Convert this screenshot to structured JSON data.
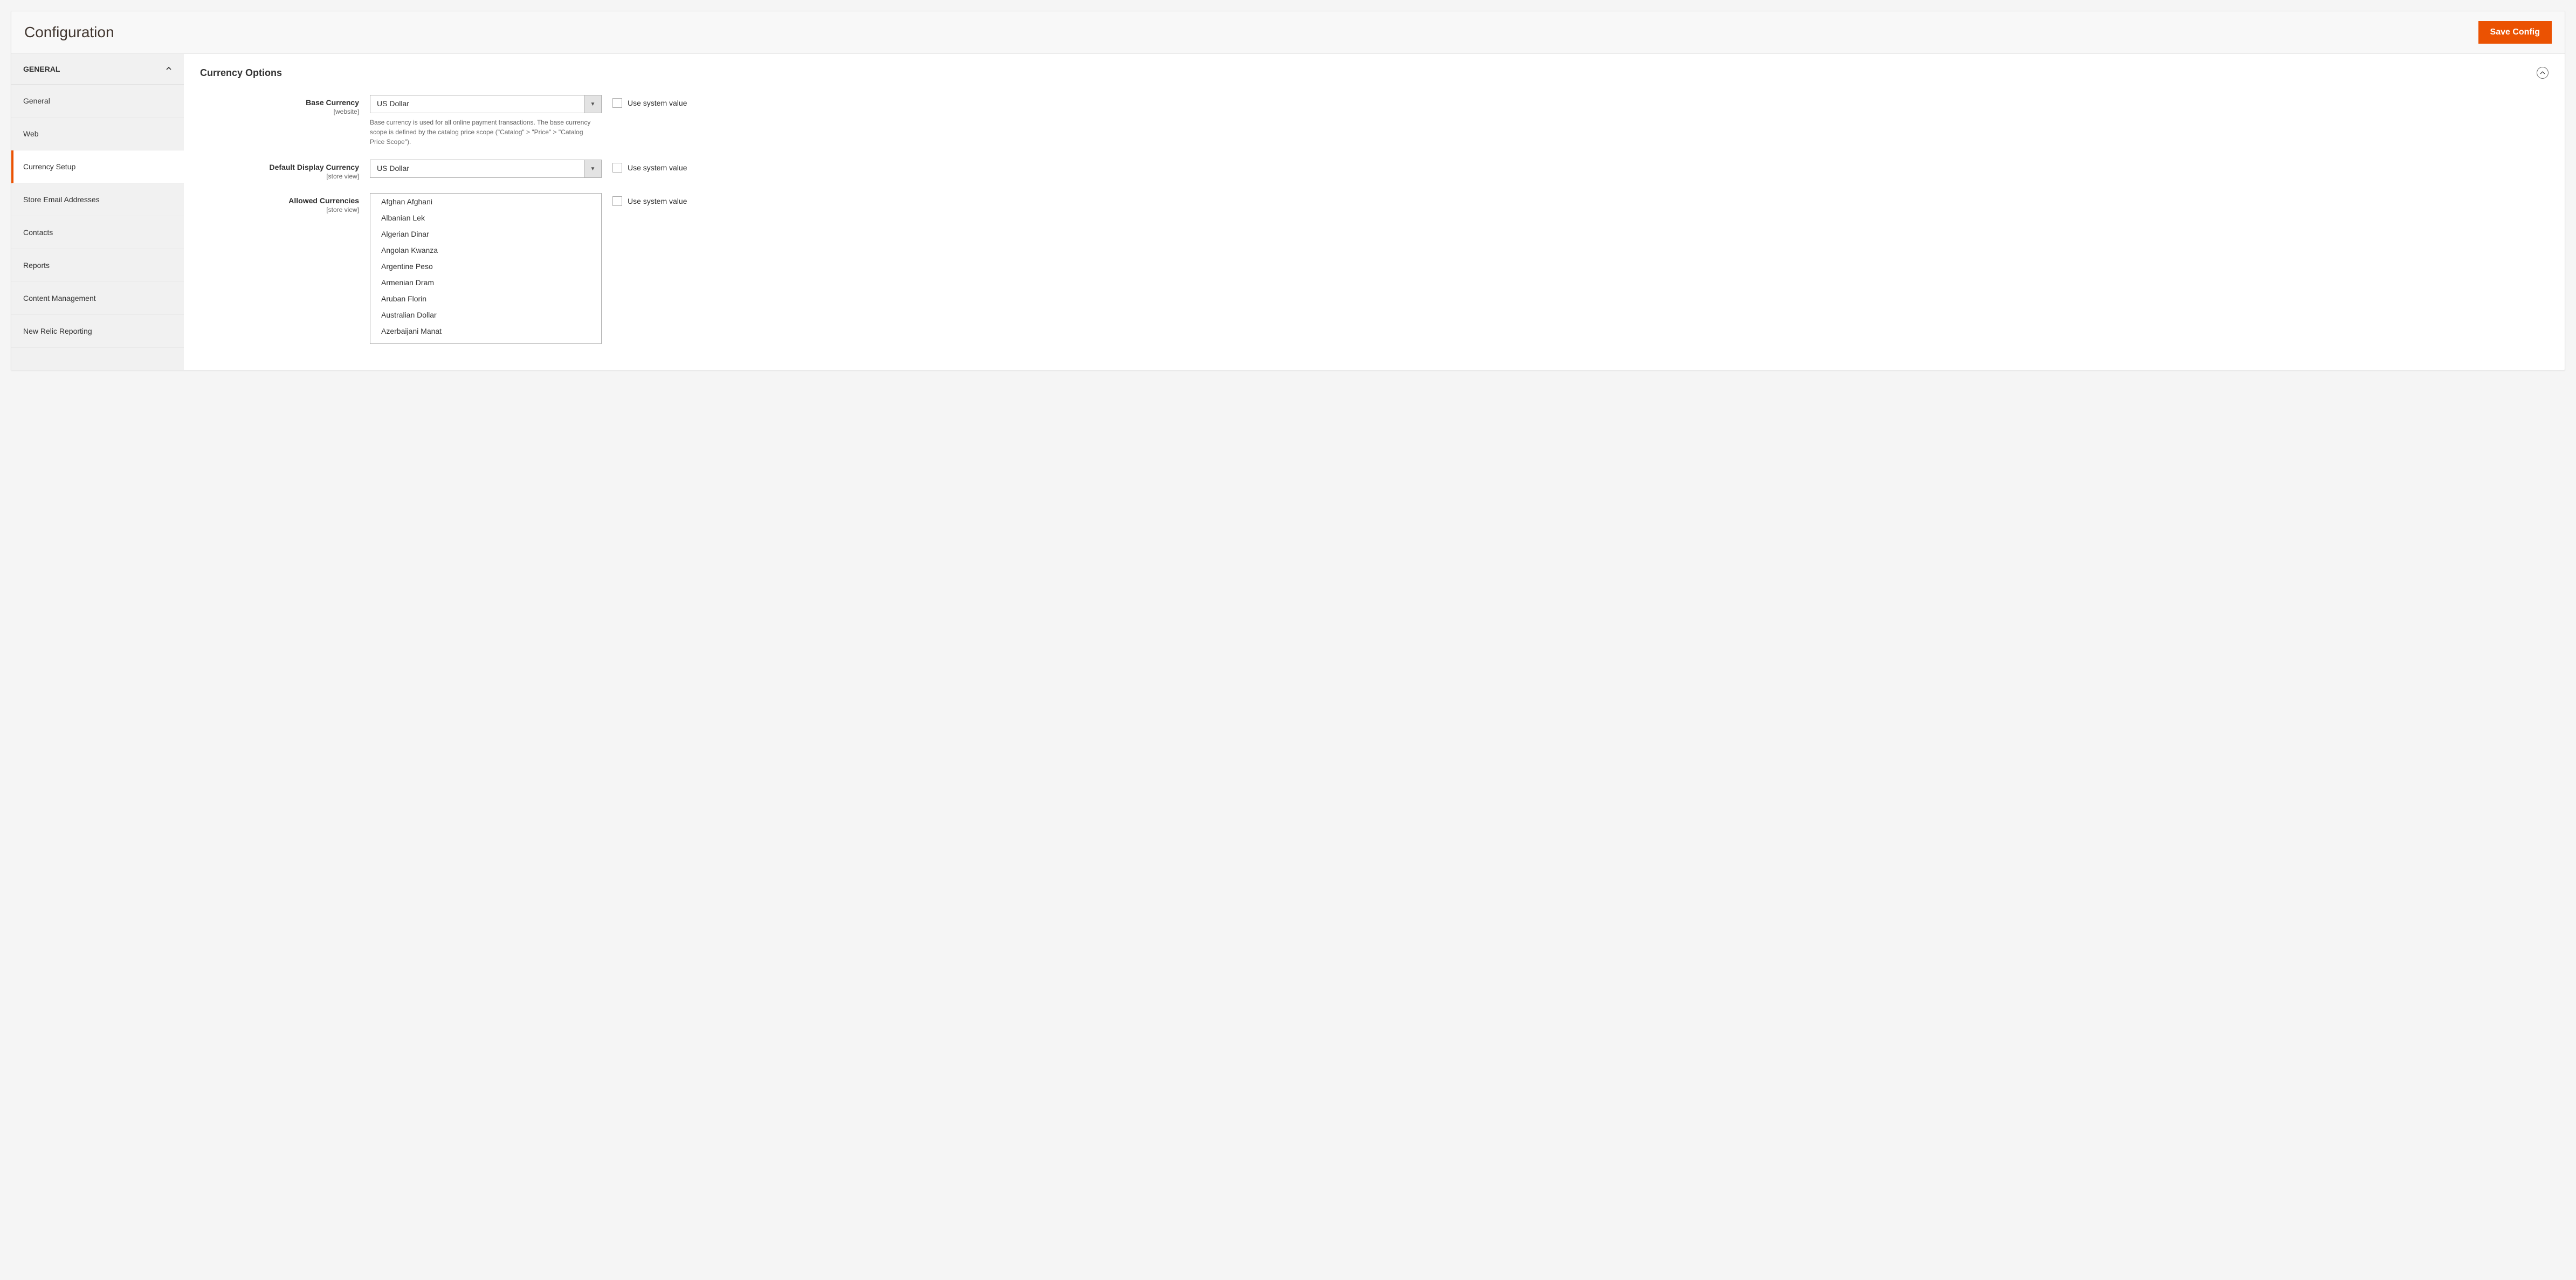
{
  "header": {
    "title": "Configuration",
    "save_button": "Save Config"
  },
  "sidebar": {
    "group_label": "General",
    "items": [
      {
        "label": "General",
        "active": false
      },
      {
        "label": "Web",
        "active": false
      },
      {
        "label": "Currency Setup",
        "active": true
      },
      {
        "label": "Store Email Addresses",
        "active": false
      },
      {
        "label": "Contacts",
        "active": false
      },
      {
        "label": "Reports",
        "active": false
      },
      {
        "label": "Content Management",
        "active": false
      },
      {
        "label": "New Relic Reporting",
        "active": false
      }
    ]
  },
  "section": {
    "title": "Currency Options"
  },
  "fields": {
    "base_currency": {
      "label": "Base Currency",
      "scope": "[website]",
      "value": "US Dollar",
      "help": "Base currency is used for all online payment transactions. The base currency scope is defined by the catalog price scope (\"Catalog\" > \"Price\" > \"Catalog Price Scope\").",
      "use_system_label": "Use system value"
    },
    "default_display_currency": {
      "label": "Default Display Currency",
      "scope": "[store view]",
      "value": "US Dollar",
      "use_system_label": "Use system value"
    },
    "allowed_currencies": {
      "label": "Allowed Currencies",
      "scope": "[store view]",
      "options": [
        "Afghan Afghani",
        "Albanian Lek",
        "Algerian Dinar",
        "Angolan Kwanza",
        "Argentine Peso",
        "Armenian Dram",
        "Aruban Florin",
        "Australian Dollar",
        "Azerbaijani Manat"
      ],
      "use_system_label": "Use system value"
    }
  }
}
